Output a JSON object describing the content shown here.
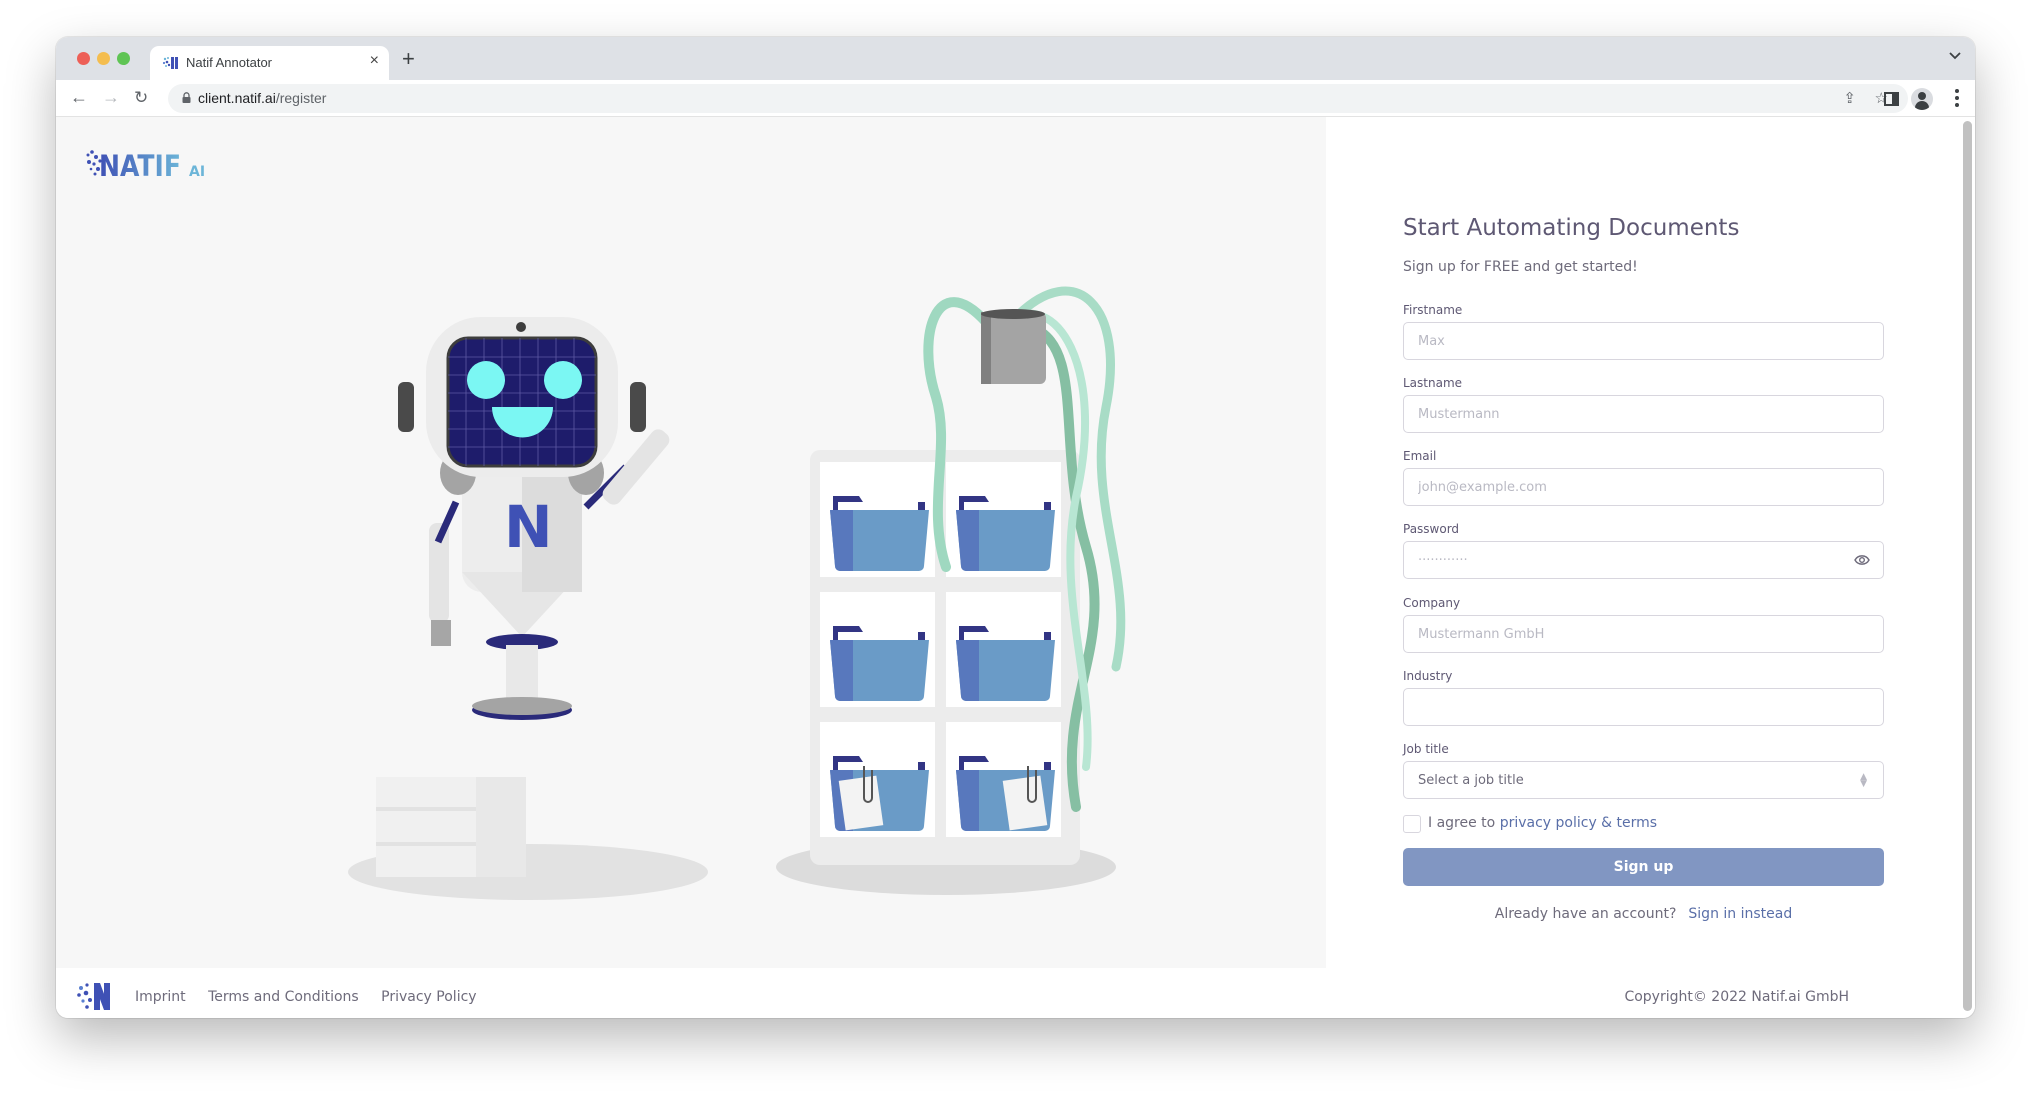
{
  "browser": {
    "tab_title": "Natif Annotator",
    "tab_close": "×",
    "new_tab": "+",
    "tab_dropdown": "⌄",
    "url_host": "client.natif.ai",
    "url_path": "/register",
    "nav": {
      "back": "←",
      "forward": "→",
      "reload": "↻"
    },
    "omnibox_icons": {
      "share": "⇪",
      "bookmark": "☆"
    }
  },
  "brand": {
    "logo_text": "NATIF",
    "logo_suffix": "AI",
    "colors": {
      "primary": "#3f51b5",
      "logo_gradient_end": "#6cb5d8",
      "button": "#8196c2",
      "link": "#5a6fa8",
      "heading": "#5e5873"
    }
  },
  "form": {
    "heading": "Start Automating Documents",
    "subtitle": "Sign up for FREE and get started!",
    "fields": [
      {
        "label": "Firstname",
        "placeholder": "Max",
        "value": ""
      },
      {
        "label": "Lastname",
        "placeholder": "Mustermann",
        "value": ""
      },
      {
        "label": "Email",
        "placeholder": "john@example.com",
        "value": ""
      },
      {
        "label": "Password",
        "placeholder": "············",
        "value": ""
      },
      {
        "label": "Company",
        "placeholder": "Mustermann GmbH",
        "value": ""
      },
      {
        "label": "Industry",
        "placeholder": "",
        "value": ""
      }
    ],
    "job_title": {
      "label": "Job title",
      "selected": "Select a job title"
    },
    "agree": {
      "prefix": "I agree to ",
      "link": "privacy policy & terms",
      "checked": false
    },
    "submit": "Sign up",
    "signin": {
      "prompt": "Already have an account?",
      "link": "Sign in instead"
    }
  },
  "footer": {
    "links": [
      "Imprint",
      "Terms and Conditions",
      "Privacy Policy"
    ],
    "copyright": "Copyright© 2022 Natif.ai GmbH"
  }
}
